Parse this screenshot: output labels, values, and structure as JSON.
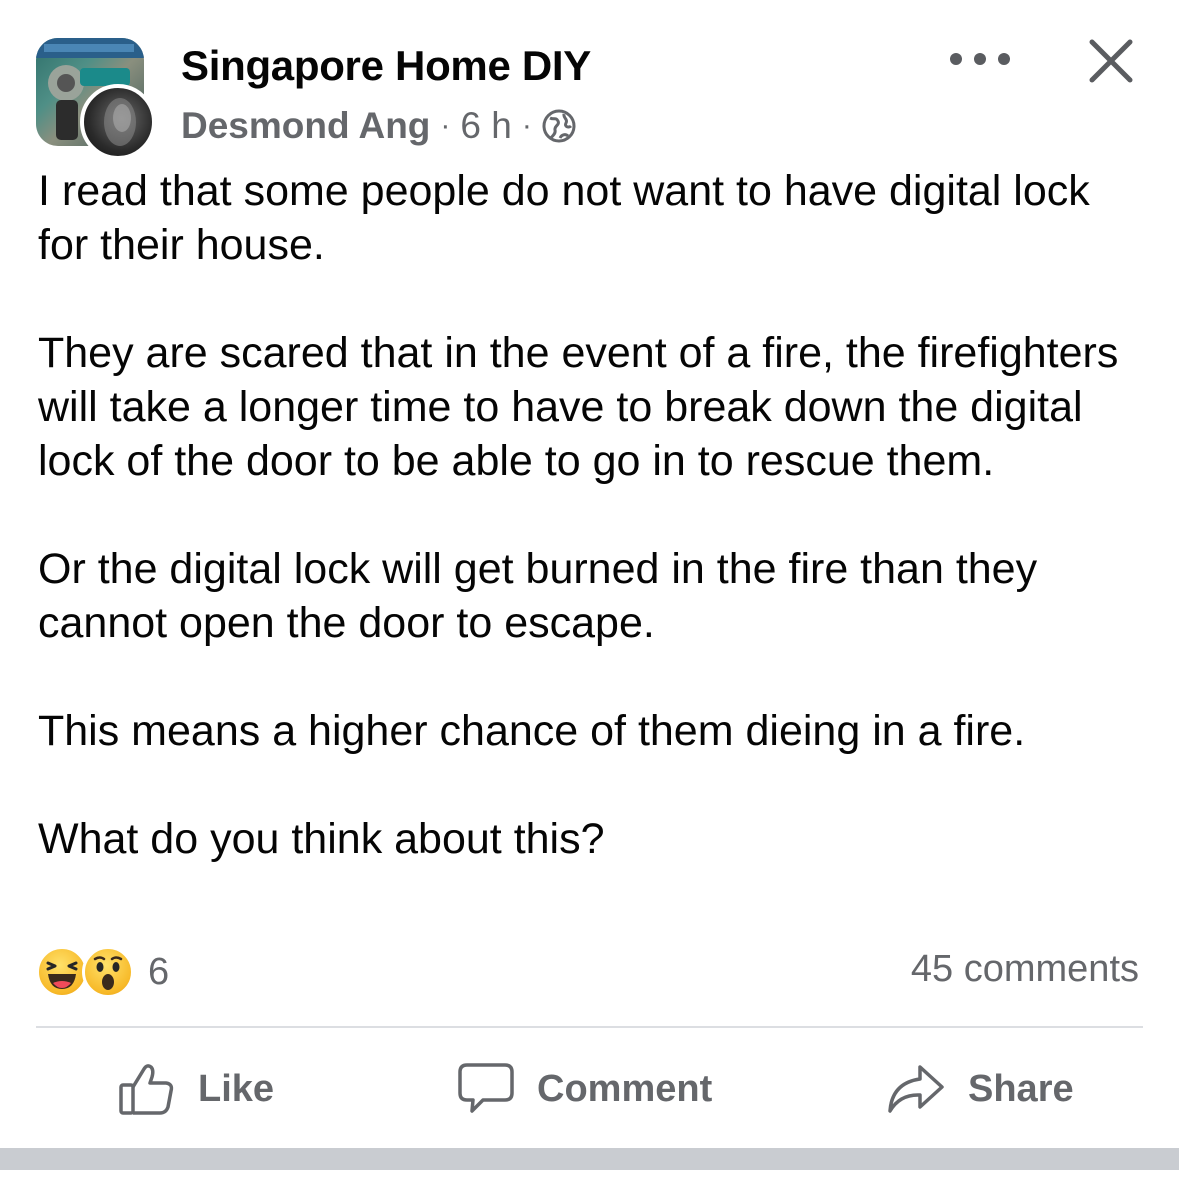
{
  "post": {
    "group_name": "Singapore Home DIY",
    "author": "Desmond Ang",
    "separator": "·",
    "time": "6 h",
    "privacy_icon": "globe-icon",
    "paragraphs": [
      "I read that some people do not want to have digital lock for their house.",
      "They are scared that in the event of a fire, the firefighters will take a longer time to have to break down the digital lock of the door to be able to go in to rescue them.",
      "Or the digital lock will get burned in the fire than they cannot open the door to escape.",
      "This means a higher chance of them dieing in a fire.",
      "What do you think about this?"
    ],
    "reactions": {
      "icons": [
        "haha-reaction-icon",
        "wow-reaction-icon"
      ],
      "count": "6"
    },
    "comments_count": "45 comments"
  },
  "actions": {
    "like": "Like",
    "comment": "Comment",
    "share": "Share"
  },
  "colors": {
    "text": "#050505",
    "secondary": "#65676b",
    "divider": "#dcdee2",
    "reaction_yellow": "#f7b928"
  }
}
